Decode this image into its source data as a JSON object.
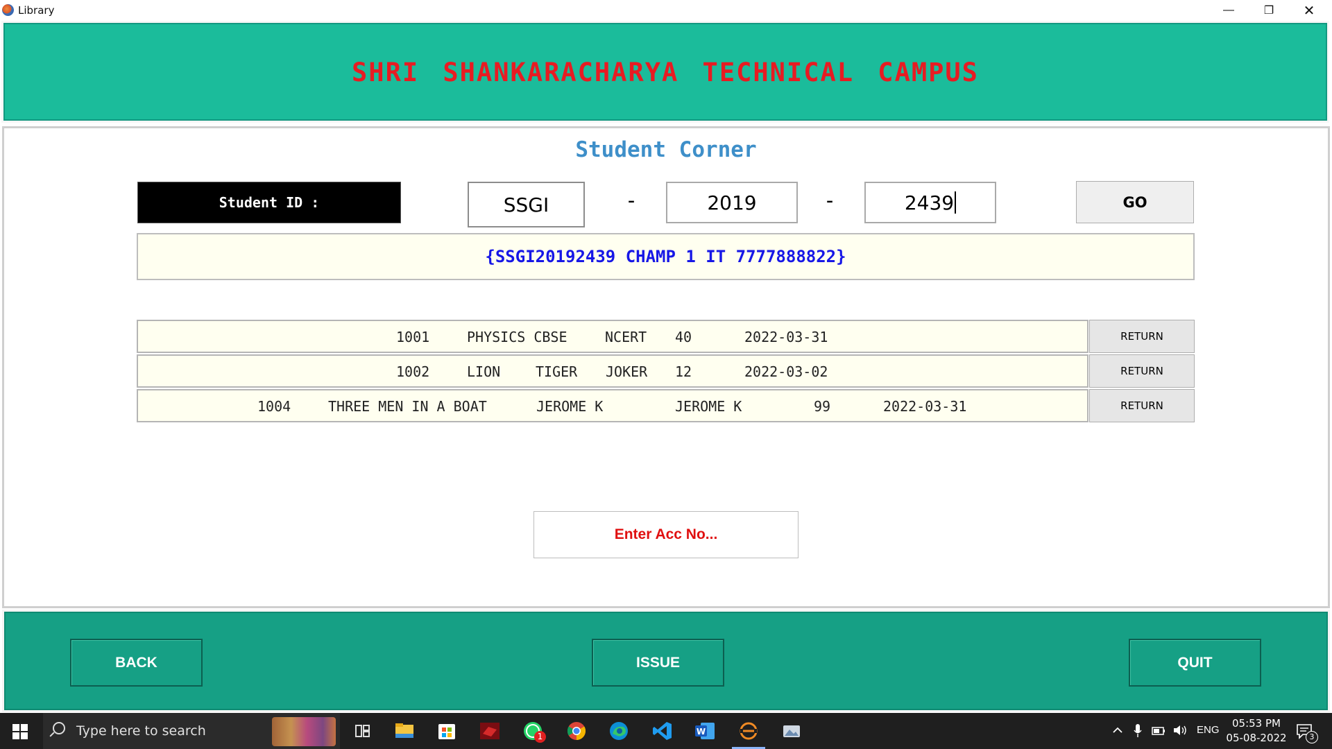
{
  "window": {
    "title": "Library",
    "minimize": "—",
    "maximize": "❐",
    "close": "✕"
  },
  "header": {
    "title": "SHRI SHANKARACHARYA TECHNICAL CAMPUS",
    "title_color": "#e81b22",
    "bg_color": "#1bbc9b"
  },
  "main": {
    "section_title": "Student Corner",
    "student_id_label": "Student ID :",
    "id_part1": "SSGI",
    "id_sep1": "-",
    "id_part2": "2019",
    "id_sep2": "-",
    "id_part3": "2439",
    "go_label": "GO",
    "student_info": "{SSGI20192439 CHAMP 1 IT 7777888822}",
    "books": [
      {
        "acc_no": "1001",
        "title": "PHYSICS CBSE",
        "author": "NCERT",
        "publisher": "",
        "price": "40",
        "date": "2022-03-31",
        "action": "RETURN"
      },
      {
        "acc_no": "1002",
        "title": "LION",
        "author": "TIGER",
        "publisher": "JOKER",
        "price": "12",
        "date": "2022-03-02",
        "action": "RETURN"
      },
      {
        "acc_no": "1004",
        "title": "THREE MEN IN A BOAT",
        "author": "JEROME K",
        "publisher": "JEROME K",
        "price": "99",
        "date": "2022-03-31",
        "action": "RETURN"
      }
    ],
    "acc_placeholder": "Enter Acc No..."
  },
  "footer": {
    "back_label": "BACK",
    "issue_label": "ISSUE",
    "quit_label": "QUIT",
    "bg_color": "#16a085"
  },
  "taskbar": {
    "search_placeholder": "Type here to search",
    "icons": [
      "windows-start-icon",
      "task-view-icon",
      "file-explorer-icon",
      "ms-store-icon",
      "app-red-icon",
      "whatsapp-icon",
      "chrome-icon",
      "edge-icon",
      "vscode-icon",
      "word-icon",
      "library-app-icon",
      "photos-icon"
    ],
    "whatsapp_badge": "1",
    "lang": "ENG",
    "time": "05:53 PM",
    "date": "05-08-2022",
    "notification_count": "3"
  }
}
